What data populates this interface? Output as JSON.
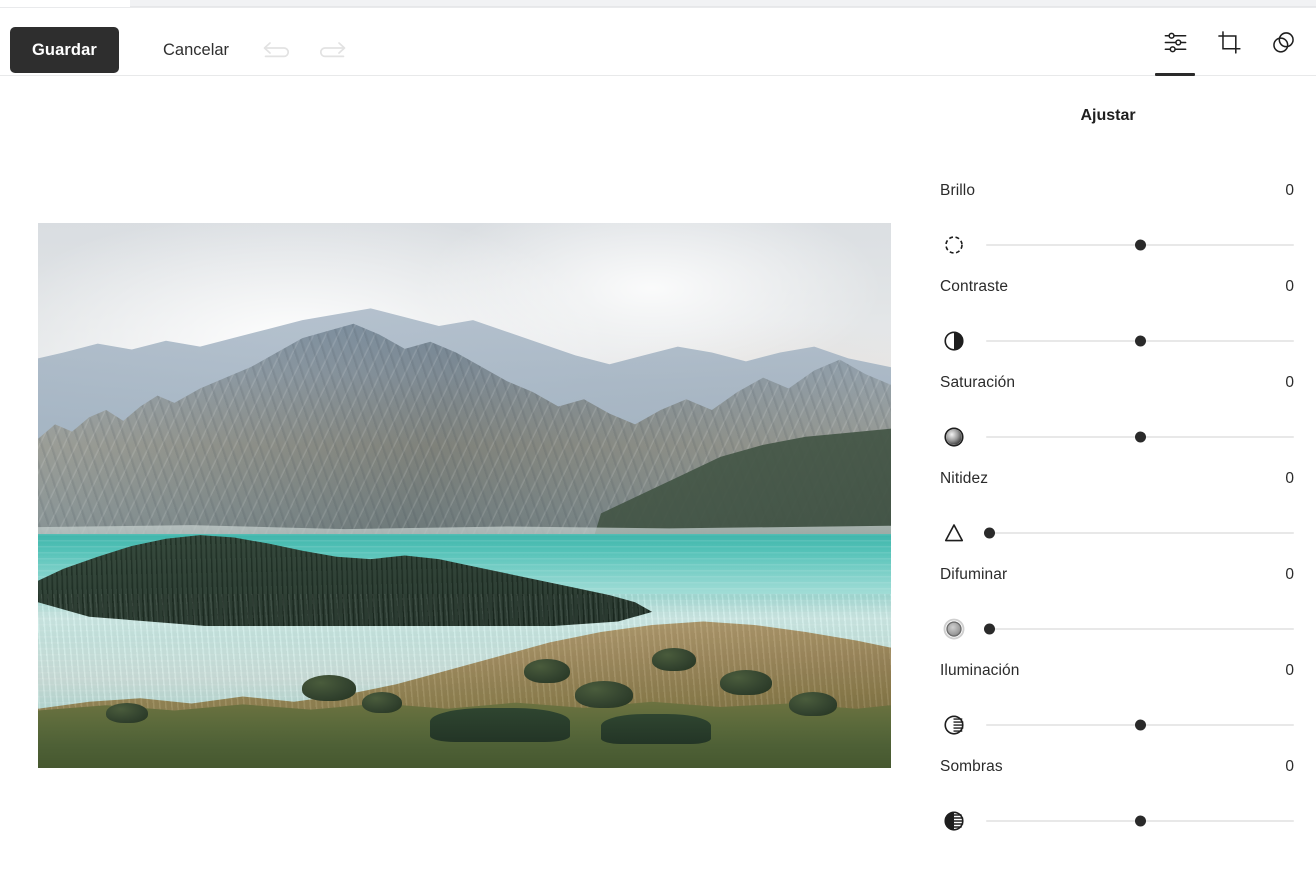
{
  "toolbar": {
    "save_label": "Guardar",
    "cancel_label": "Cancelar",
    "undo_icon": "undo-arrow-icon",
    "redo_icon": "redo-arrow-icon",
    "tools": [
      {
        "name": "adjust-tool",
        "icon": "sliders-icon",
        "active": true
      },
      {
        "name": "crop-tool",
        "icon": "crop-icon",
        "active": false
      },
      {
        "name": "filters-tool",
        "icon": "overlapping-circles-icon",
        "active": false
      }
    ]
  },
  "panel": {
    "title": "Ajustar",
    "sliders": [
      {
        "label": "Brillo",
        "value": "0",
        "icon": "brightness-icon",
        "thumb_pct": 50
      },
      {
        "label": "Contraste",
        "value": "0",
        "icon": "contrast-icon",
        "thumb_pct": 50
      },
      {
        "label": "Saturación",
        "value": "0",
        "icon": "saturation-icon",
        "thumb_pct": 50
      },
      {
        "label": "Nitidez",
        "value": "0",
        "icon": "sharpen-icon",
        "thumb_pct": 1
      },
      {
        "label": "Difuminar",
        "value": "0",
        "icon": "blur-icon",
        "thumb_pct": 1
      },
      {
        "label": "Iluminación",
        "value": "0",
        "icon": "highlights-icon",
        "thumb_pct": 50
      },
      {
        "label": "Sombras",
        "value": "0",
        "icon": "shadows-icon",
        "thumb_pct": 50
      }
    ]
  },
  "photo": {
    "alt": "Lago turquesa rodeado de montañas con pradera dorada en primer plano"
  },
  "colors": {
    "save_button_bg": "#2e2e2e",
    "save_button_text": "#ffffff",
    "text": "#2b2b2b",
    "track": "#e8e8e8",
    "thumb": "#2a2a2a",
    "active_underline": "#2a2a2a",
    "panel_bg": "#ffffff"
  }
}
